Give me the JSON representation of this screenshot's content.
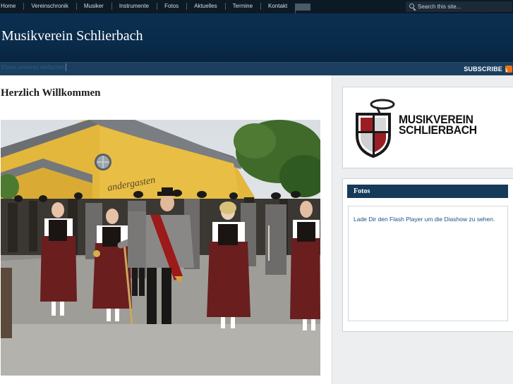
{
  "nav": {
    "items": [
      "Home",
      "Vereinschronik",
      "Musiker",
      "Instrumente",
      "Fotos",
      "Aktuelles",
      "Termine",
      "Kontakt"
    ],
    "search_placeholder": "Search this site..."
  },
  "header": {
    "site_title": "Musikverein Schlierbach",
    "tagline": "Etwas anderes einfachen"
  },
  "subbar": {
    "subscribe_label": "SUBSCRIBE"
  },
  "main": {
    "heading": "Herzlich Willkommen",
    "photo_sign": "andergasten"
  },
  "sidebar": {
    "logo": {
      "line1": "MUSIKVEREIN",
      "line2": "SCHLIERBACH"
    },
    "fotos": {
      "title": "Fotos",
      "flash_link": "Lade Dir den Flash Player",
      "flash_rest": " um die Diashow zu sehen."
    }
  },
  "colors": {
    "nav_bg": "#0c1a26",
    "header_bg": "#0b2f50",
    "subbar_bg": "#1c3f5f",
    "widget_title_bg": "#163a5a",
    "link": "#1c4f86",
    "rss": "#e8731c"
  }
}
